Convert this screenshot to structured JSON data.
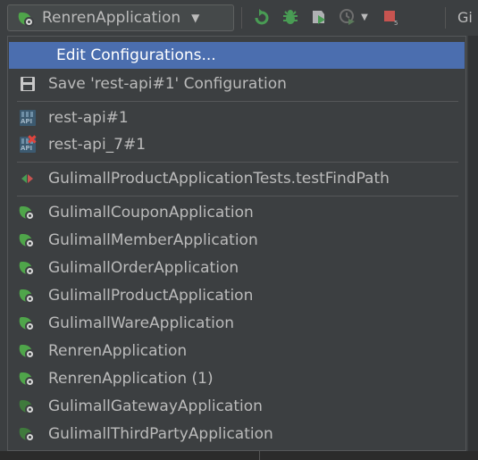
{
  "toolbar": {
    "run_config_label": "RenrenApplication",
    "cut_text": "Gi"
  },
  "menu": {
    "edit_configurations": "Edit Configurations...",
    "save_configuration": "Save 'rest-api#1' Configuration",
    "http_requests": [
      {
        "label": "rest-api#1",
        "icon": "api-icon"
      },
      {
        "label": "rest-api_7#1",
        "icon": "api-error-icon"
      }
    ],
    "test_item": "GulimallProductApplicationTests.testFindPath",
    "applications": [
      {
        "label": "GulimallCouponApplication"
      },
      {
        "label": "GulimallMemberApplication"
      },
      {
        "label": "GulimallOrderApplication"
      },
      {
        "label": "GulimallProductApplication"
      },
      {
        "label": "GulimallWareApplication"
      },
      {
        "label": "RenrenApplication"
      },
      {
        "label": "RenrenApplication (1)"
      },
      {
        "label": "GulimallGatewayApplication"
      },
      {
        "label": "GulimallThirdPartyApplication"
      }
    ]
  },
  "colors": {
    "background": "#3c3f41",
    "selection": "#4b6eaf",
    "text": "#bbbbbb",
    "spring_green": "#4fa54a",
    "run_green": "#499c54",
    "stop_red": "#c75450"
  }
}
